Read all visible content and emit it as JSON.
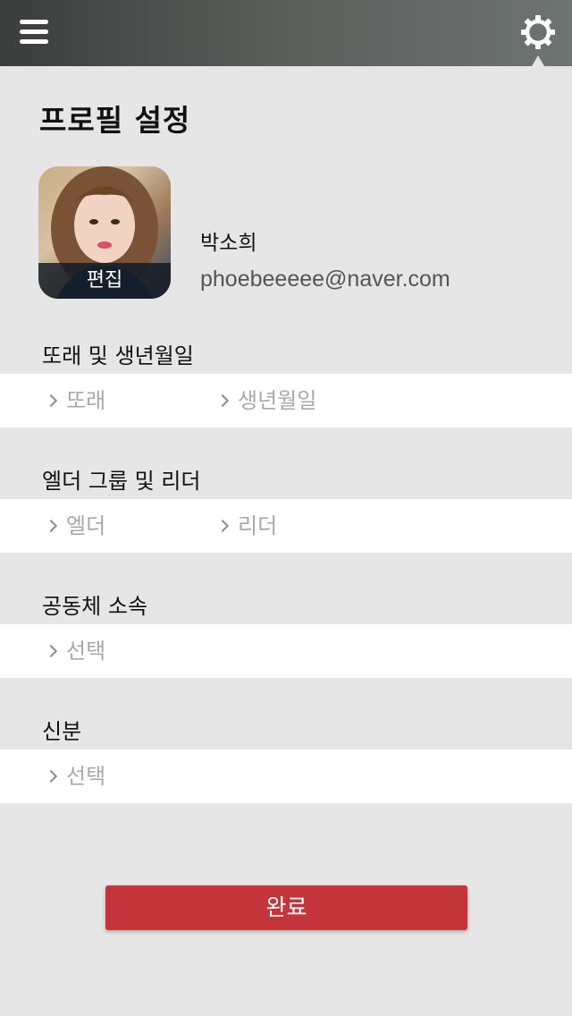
{
  "header": {
    "menu_icon": "hamburger-menu-icon",
    "settings_icon": "gear-icon",
    "background": "#4a4f4d"
  },
  "page": {
    "title": "프로필 설정"
  },
  "profile": {
    "edit_label": "편집",
    "name": "박소희",
    "email": "phoebeeeee@naver.com"
  },
  "sections": {
    "peer_birth": {
      "label": "또래 및 생년월일",
      "peer": "또래",
      "birthdate": "생년월일"
    },
    "elder_leader": {
      "label": "엘더 그룹 및 리더",
      "elder": "엘더",
      "leader": "리더"
    },
    "community": {
      "label": "공동체 소속",
      "select": "선택"
    },
    "status": {
      "label": "신분",
      "select": "선택"
    }
  },
  "footer": {
    "done_label": "완료",
    "accent": "#c3353a"
  }
}
